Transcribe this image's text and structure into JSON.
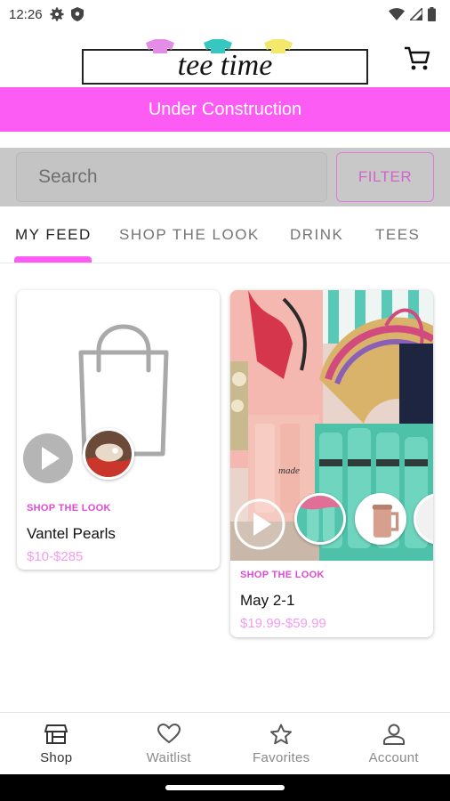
{
  "status_bar": {
    "time": "12:26"
  },
  "header": {
    "logo_text": "tee time"
  },
  "banner": {
    "text": "Under Construction"
  },
  "search": {
    "placeholder": "Search",
    "filter_label": "FILTER"
  },
  "tabs": [
    {
      "label": "MY FEED",
      "active": true
    },
    {
      "label": "SHOP THE LOOK",
      "active": false
    },
    {
      "label": "DRINK",
      "active": false
    },
    {
      "label": "TEES",
      "active": false
    }
  ],
  "cards": [
    {
      "kicker": "SHOP THE LOOK",
      "title": "Vantel Pearls",
      "price": "$10-$285",
      "media": "shopping-bag-placeholder-icon"
    },
    {
      "kicker": "SHOP THE LOOK",
      "title": "May 2-1",
      "price": "$19.99-$59.99",
      "media": "product-photo"
    }
  ],
  "bottom_nav": [
    {
      "label": "Shop",
      "icon": "store-icon",
      "active": true
    },
    {
      "label": "Waitlist",
      "icon": "heart-icon",
      "active": false
    },
    {
      "label": "Favorites",
      "icon": "star-icon",
      "active": false
    },
    {
      "label": "Account",
      "icon": "person-icon",
      "active": false
    }
  ],
  "colors": {
    "accent": "#fd5cf4",
    "price": "#f29cee",
    "kicker": "#e04bd6"
  }
}
